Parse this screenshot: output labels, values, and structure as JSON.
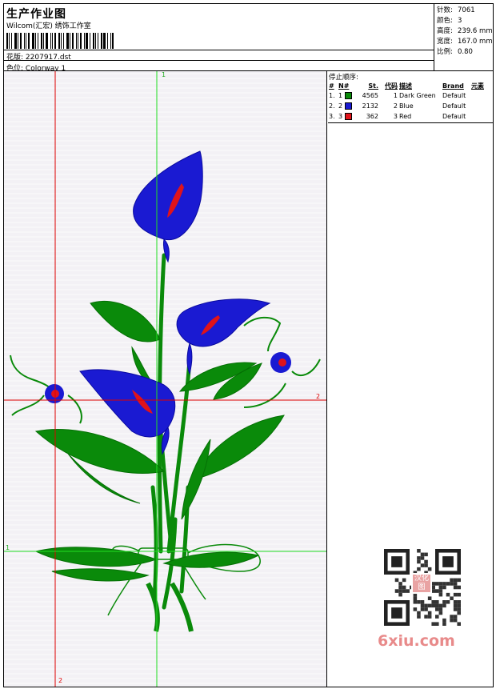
{
  "header": {
    "title": "生产作业图",
    "company": "Wilcom(汇宏) 绣饰工作室",
    "design_label": "花版:",
    "design_value": "2207917.dst",
    "colorway_label": "色位:",
    "colorway_value": "Colorway 1"
  },
  "stats": {
    "stitches_label": "针数:",
    "stitches_value": "7061",
    "colors_label": "颜色:",
    "colors_value": "3",
    "height_label": "高度:",
    "height_value": "239.6 mm",
    "width_label": "宽度:",
    "width_value": "167.0 mm",
    "scale_label": "比例:",
    "scale_value": "0.80"
  },
  "stop_sequence": {
    "title": "停止顺序:",
    "headers": [
      "#",
      "N#",
      "St.",
      "代码",
      "描述",
      "Brand",
      "元素"
    ],
    "rows": [
      {
        "idx": "1.",
        "n": "1",
        "color": "#0a8a0a",
        "st": "4565",
        "code": "1",
        "desc": "Dark Green",
        "brand": "Default"
      },
      {
        "idx": "2.",
        "n": "2",
        "color": "#1a1ad2",
        "st": "2132",
        "code": "2",
        "desc": "Blue",
        "brand": "Default"
      },
      {
        "idx": "3.",
        "n": "3",
        "color": "#e0131a",
        "st": "362",
        "code": "3",
        "desc": "Red",
        "brand": "Default"
      }
    ]
  },
  "guides": {
    "v_green_label": "1",
    "h_red_label": "2",
    "h_green_label": "1",
    "v_red_label": "2"
  },
  "watermark": {
    "site": "6xiu.com",
    "qr_mark": "汉化图"
  },
  "colors": {
    "green": "#0a8a0a",
    "blue": "#1a1ad2",
    "red": "#e0131a",
    "guide_green": "#22dd22",
    "guide_red": "#dd0000"
  }
}
